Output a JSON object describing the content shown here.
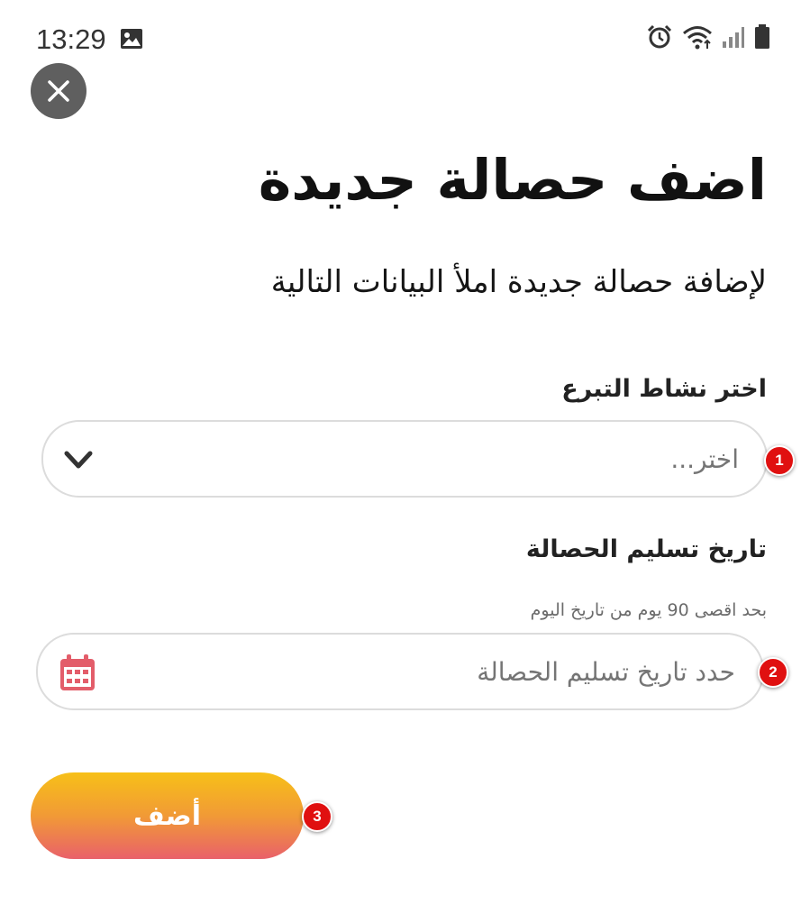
{
  "status_bar": {
    "time": "13:29",
    "icons": [
      "gallery-icon",
      "alarm-icon",
      "wifi-icon",
      "signal-icon",
      "battery-icon"
    ]
  },
  "close_icon": "close-icon",
  "title": "اضف حصالة جديدة",
  "subtitle": "لإضافة حصالة جديدة املأ البيانات التالية",
  "activity_field": {
    "label": "اختر نشاط التبرع",
    "placeholder": "اختر...",
    "icon": "chevron-down-icon",
    "badge": "1"
  },
  "date_field": {
    "label": "تاريخ تسليم الحصالة",
    "hint": "بحد اقصى 90 يوم من تاريخ اليوم",
    "placeholder": "حدد تاريخ تسليم الحصالة",
    "icon": "calendar-icon",
    "badge": "2"
  },
  "add_button": {
    "label": "أضف",
    "badge": "3"
  },
  "colors": {
    "button_gradient_top": "#f7c018",
    "button_gradient_bottom": "#e9616a",
    "calendar_icon": "#e35d6a",
    "badge": "#e01010",
    "close_button_bg": "#5f5f5f"
  }
}
